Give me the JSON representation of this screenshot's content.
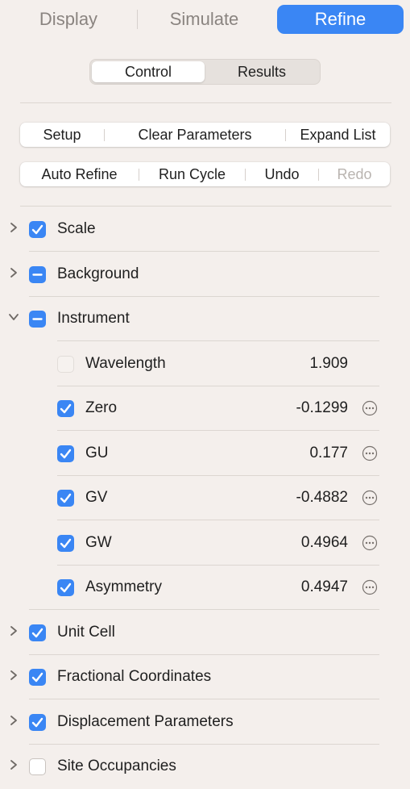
{
  "tabs": {
    "display": "Display",
    "simulate": "Simulate",
    "refine": "Refine",
    "active": "Refine"
  },
  "segmented": {
    "control": "Control",
    "results": "Results",
    "active": "Control"
  },
  "toolbar1": {
    "setup": "Setup",
    "clear_parameters": "Clear Parameters",
    "expand_list": "Expand List"
  },
  "toolbar2": {
    "auto_refine": "Auto Refine",
    "run_cycle": "Run Cycle",
    "undo": "Undo",
    "redo": "Redo"
  },
  "tree": {
    "scale": {
      "label": "Scale",
      "state": "checked",
      "expanded": false
    },
    "background": {
      "label": "Background",
      "state": "mixed",
      "expanded": false
    },
    "instrument": {
      "label": "Instrument",
      "state": "mixed",
      "expanded": true,
      "children": {
        "wavelength": {
          "label": "Wavelength",
          "value": "1.909",
          "state": "disabled"
        },
        "zero": {
          "label": "Zero",
          "value": "-0.1299",
          "state": "checked"
        },
        "gu": {
          "label": "GU",
          "value": "0.177",
          "state": "checked"
        },
        "gv": {
          "label": "GV",
          "value": "-0.4882",
          "state": "checked"
        },
        "gw": {
          "label": "GW",
          "value": "0.4964",
          "state": "checked"
        },
        "asymmetry": {
          "label": "Asymmetry",
          "value": "0.4947",
          "state": "checked"
        }
      }
    },
    "unit_cell": {
      "label": "Unit Cell",
      "state": "checked",
      "expanded": false
    },
    "fractional_coordinates": {
      "label": "Fractional Coordinates",
      "state": "checked",
      "expanded": false
    },
    "displacement_parameters": {
      "label": "Displacement Parameters",
      "state": "checked",
      "expanded": false
    },
    "site_occupancies": {
      "label": "Site Occupancies",
      "state": "unchecked",
      "expanded": false
    }
  },
  "icons": {
    "chevron_collapsed": "chevron-right-icon",
    "chevron_expanded": "chevron-down-icon",
    "more": "ellipsis-circle-icon",
    "check": "checkmark-icon",
    "mixed": "minus-icon"
  },
  "colors": {
    "accent": "#3a86f4",
    "background": "#f4efec",
    "separator": "#dcd6d1",
    "disabled_text": "#b9b4b0"
  }
}
